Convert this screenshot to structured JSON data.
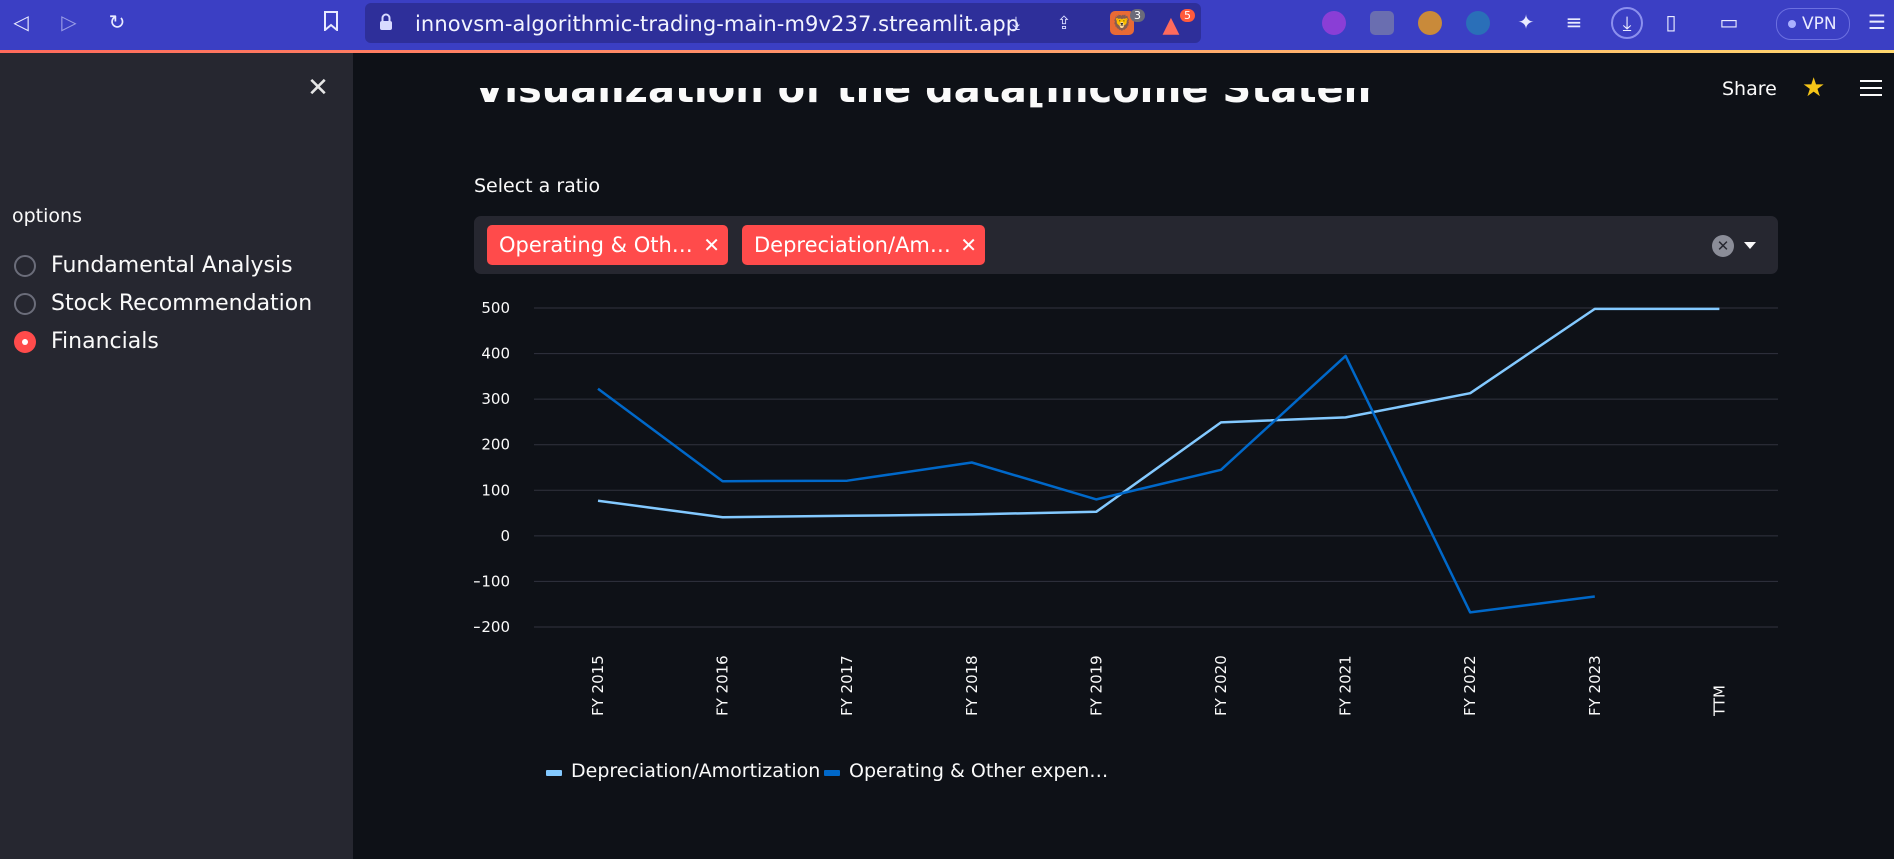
{
  "browser": {
    "url": "innovsm-algorithmic-trading-main-m9v237.streamlit.app",
    "shields_badge": "3",
    "rewards_badge": "5",
    "vpn_label": "VPN"
  },
  "sidebar": {
    "group_label": "options",
    "options": [
      {
        "label": "Fundamental Analysis",
        "selected": false
      },
      {
        "label": "Stock Recommendation",
        "selected": false
      },
      {
        "label": "Financials",
        "selected": true
      }
    ]
  },
  "header": {
    "share_label": "Share"
  },
  "main": {
    "title": "Visualization of the data[Income Statement]",
    "select_label": "Select a ratio",
    "selected_tags": [
      "Operating & Oth…",
      "Depreciation/Am…"
    ]
  },
  "colors": {
    "accent": "#ff4b4b",
    "series_light": "#83c9ff",
    "series_dark": "#0068c9"
  },
  "chart_data": {
    "type": "line",
    "categories": [
      "FY 2015",
      "FY 2016",
      "FY 2017",
      "FY 2018",
      "FY 2019",
      "FY 2020",
      "FY 2021",
      "FY 2022",
      "FY 2023",
      "TTM"
    ],
    "y_ticks": [
      500,
      400,
      300,
      200,
      100,
      0,
      -100,
      -200
    ],
    "y_tick_labels": [
      "500",
      "400",
      "300",
      "200",
      "100",
      "0",
      "−100",
      "−200"
    ],
    "ylim": [
      -200,
      500
    ],
    "grid": true,
    "legend_position": "bottom",
    "series": [
      {
        "name": "Depreciation/Amortization",
        "color": "#83c9ff",
        "values": [
          77,
          41,
          44,
          47,
          53,
          249,
          260,
          313,
          498,
          498
        ]
      },
      {
        "name": "Operating & Other expen…",
        "color": "#0068c9",
        "values": [
          323,
          120,
          121,
          161,
          80,
          145,
          395,
          -168,
          -133,
          null
        ]
      }
    ]
  }
}
